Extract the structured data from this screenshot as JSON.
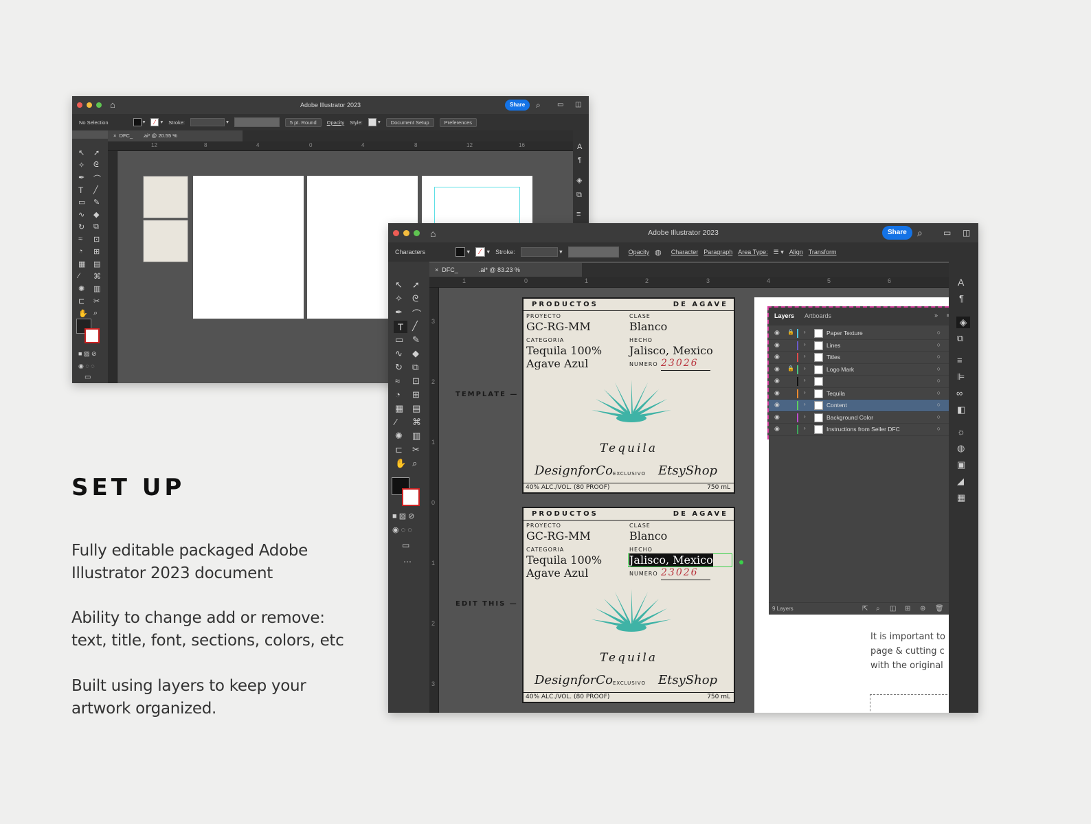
{
  "marketing": {
    "heading": "SET UP",
    "paragraphs": [
      "Fully editable packaged Adobe Illustrator 2023 document",
      "Ability to change add or remove: text, title, font, sections, colors, etc",
      "Built using layers to keep your artwork organized."
    ]
  },
  "window_back": {
    "title": "Adobe Illustrator 2023",
    "share": "Share",
    "control": {
      "selection": "No Selection",
      "stroke_label": "Stroke:",
      "brush": "5 pt. Round",
      "opacity": "Opacity",
      "style": "Style:",
      "document_setup": "Document Setup",
      "preferences": "Preferences"
    },
    "doc_tab": "DFC_",
    "doc_tab_suffix": ".ai* @ 20.55 %",
    "ruler_h": [
      "12",
      "8",
      "4",
      "0",
      "4",
      "8",
      "12",
      "16"
    ]
  },
  "window_front": {
    "title": "Adobe Illustrator 2023",
    "share": "Share",
    "control": {
      "mode": "Characters",
      "stroke_label": "Stroke:",
      "opacity": "Opacity",
      "character": "Character",
      "paragraph": "Paragraph",
      "area_type": "Area Type:",
      "align": "Align",
      "transform": "Transform"
    },
    "doc_tab": "DFC_",
    "doc_tab_suffix": ".ai* @ 83.23 %",
    "ruler_h": [
      "1",
      "0",
      "1",
      "2",
      "3",
      "4",
      "5",
      "6"
    ],
    "ruler_v": [
      "3",
      "2",
      "1",
      "0",
      "1",
      "2",
      "3"
    ],
    "side_labels": [
      "TEMPLATE —",
      "EDIT THIS —"
    ],
    "instructions_text": [
      "It is important to",
      "page & cutting c",
      "with the original"
    ]
  },
  "label": {
    "header_left": "PRODUCTOS",
    "header_right": "DE AGAVE",
    "proyecto_cap": "PROYECTO",
    "proyecto_val": "GC-RG-MM",
    "clase_cap": "CLASE",
    "clase_val": "Blanco",
    "categoria_cap": "CATEGORIA",
    "categoria_val1": "Tequila 100%",
    "categoria_val2": "Agave Azul",
    "hecho_cap": "HECHO",
    "hecho_val": "Jalisco, Mexico",
    "numero_cap": "NUMERO",
    "numero_val": "23026",
    "product": "Tequila",
    "brand_left": "DesignforCo",
    "exclusivo": "EXCLUSIVO",
    "brand_right": "EtsyShop",
    "abv": "40% ALC./VOL. (80 PROOF)",
    "volume": "750 mL",
    "agave_color": "#3fb3a6",
    "number_color": "#b8303a"
  },
  "layers_panel": {
    "tabs": [
      "Layers",
      "Artboards"
    ],
    "layers": [
      {
        "name": "Paper Texture",
        "color": "#4bc6e8",
        "locked": true,
        "selected": false
      },
      {
        "name": "Lines",
        "color": "#6a5acd",
        "locked": false,
        "selected": false
      },
      {
        "name": "Titles",
        "color": "#e04b4b",
        "locked": false,
        "selected": false
      },
      {
        "name": "Logo Mark",
        "color": "#4bc680",
        "locked": true,
        "selected": false
      },
      {
        "name": "",
        "color": "#111111",
        "locked": false,
        "selected": false
      },
      {
        "name": "Tequila",
        "color": "#f08a2e",
        "locked": false,
        "selected": false
      },
      {
        "name": "Content",
        "color": "#5ed05e",
        "locked": false,
        "selected": true
      },
      {
        "name": "Background Color",
        "color": "#c04bd0",
        "locked": false,
        "selected": false
      },
      {
        "name": "Instructions from Seller DFC",
        "color": "#3ea65a",
        "locked": false,
        "selected": false
      }
    ],
    "footer": "9 Layers"
  },
  "colors": {
    "accent": "#1473e6",
    "selection_highlight": "#4b6584",
    "layers_border": "#d23c9a"
  }
}
